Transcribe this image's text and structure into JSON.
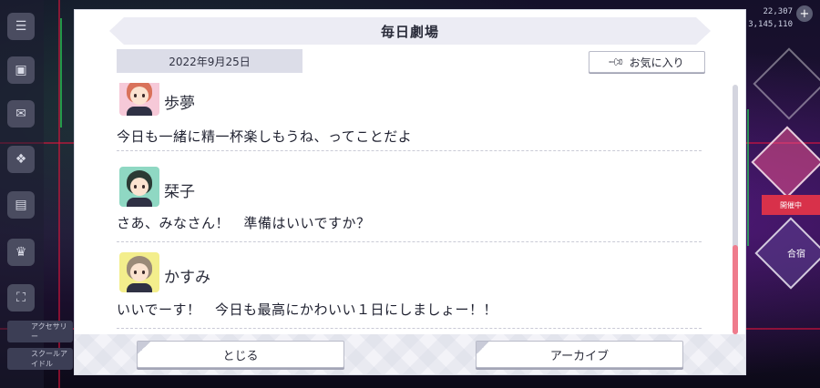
{
  "background": {
    "stat_top": "22,307",
    "stat_sub": "3,145,110",
    "plus_label": "+",
    "right_tab_label": "開催中",
    "diamond_label": "合宿",
    "left_items": [
      {
        "icon": "menu-icon",
        "glyph": "☰"
      },
      {
        "icon": "card-icon",
        "glyph": "▣"
      },
      {
        "icon": "gift-icon",
        "glyph": "✉"
      },
      {
        "icon": "present-icon",
        "glyph": "❖"
      },
      {
        "icon": "chat-icon",
        "glyph": "▤"
      },
      {
        "icon": "trophy-icon",
        "glyph": "♛"
      },
      {
        "icon": "expand-icon",
        "glyph": "⛶"
      }
    ],
    "left_wide_items": [
      "アクセサリー",
      "スクールアイドル"
    ]
  },
  "modal": {
    "title": "毎日劇場",
    "date": "2022年9月25日",
    "favorite_label": "お気に入り",
    "favorite_icon": "pin-icon",
    "entries": [
      {
        "speaker": "歩夢",
        "line": "今日も一緒に精一杯楽しもうね、ってことだよ",
        "avatar_bg": "#f6c9d8",
        "hair": "#d9725a"
      },
      {
        "speaker": "栞子",
        "line": "さあ、みなさん！　準備はいいですか？",
        "avatar_bg": "#8fd8c3",
        "hair": "#2b3a34"
      },
      {
        "speaker": "かすみ",
        "line": "いいでーす！　今日も最高にかわいい１日にしましょー！！",
        "avatar_bg": "#f3ee8c",
        "hair": "#9a8a78"
      }
    ],
    "close_label": "とじる",
    "archive_label": "アーカイブ"
  },
  "colors": {
    "accent_scroll": "#ef7b8c",
    "modal_bg": "#ffffff",
    "title_bg": "#ececf4"
  }
}
